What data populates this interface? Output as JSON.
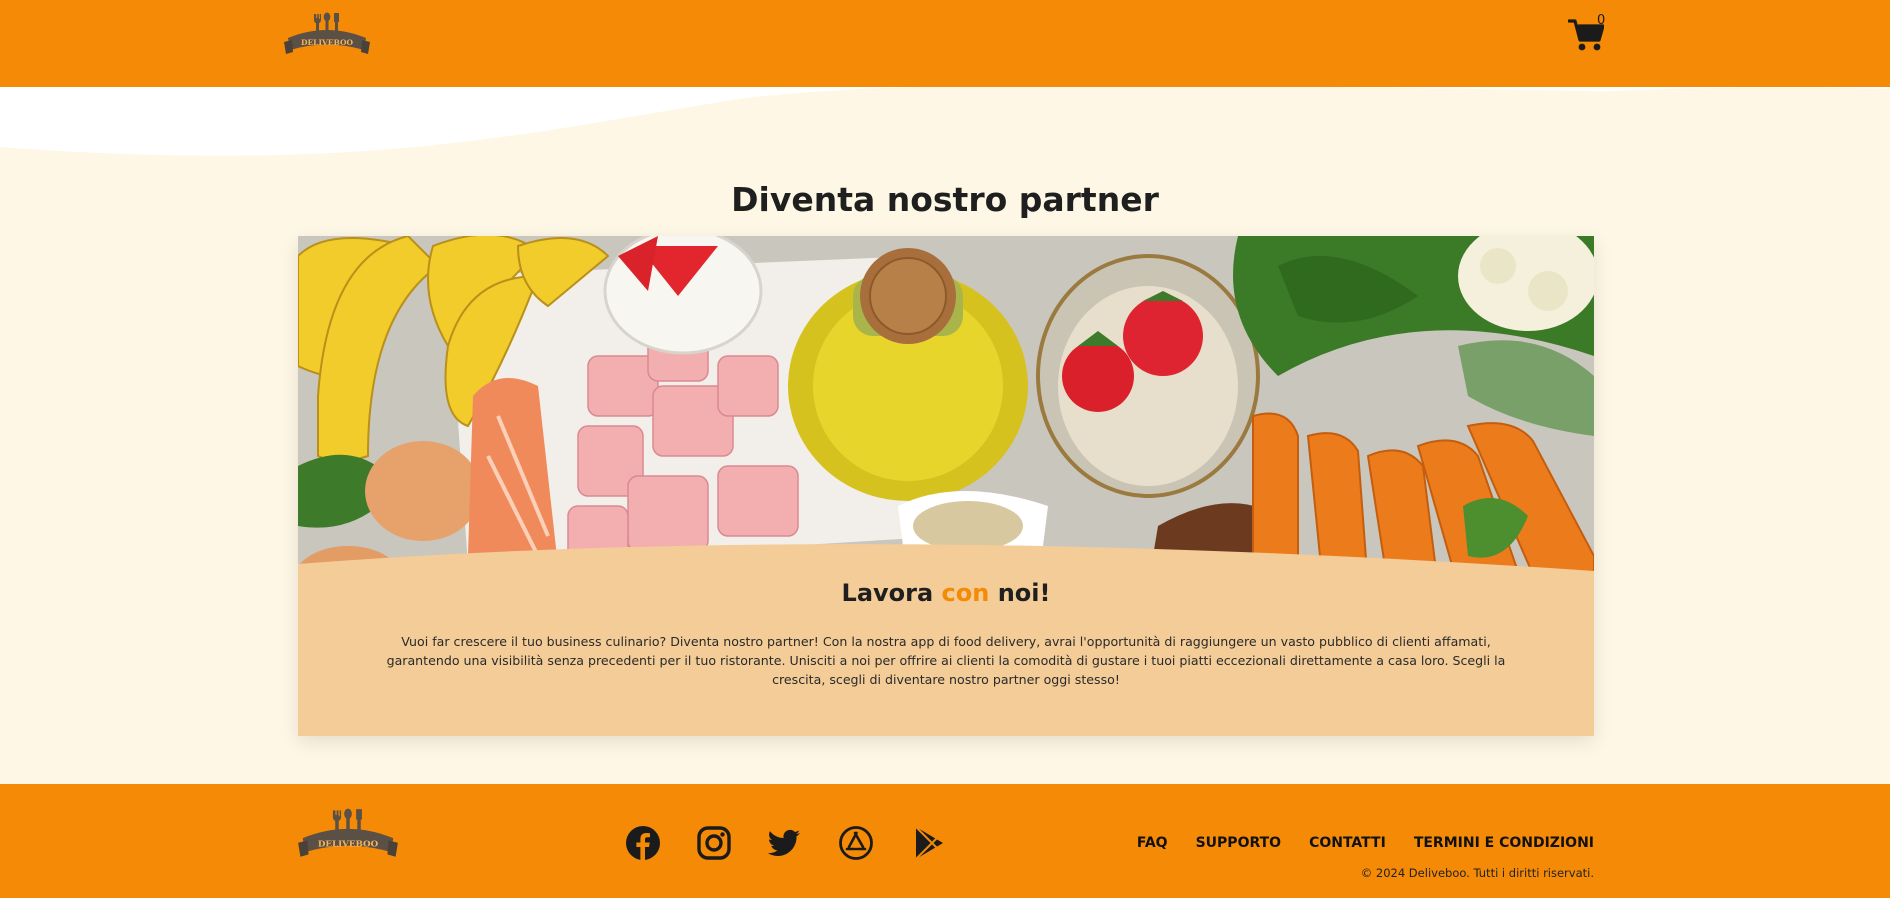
{
  "header": {
    "logo_text": "DELIVEBOO",
    "cart_count": "0"
  },
  "main": {
    "title": "Diventa nostro partner",
    "card": {
      "heading_part1": "Lavora ",
      "heading_accent": "con",
      "heading_part2": " noi!",
      "text": "Vuoi far crescere il tuo business culinario? Diventa nostro partner! Con la nostra app di food delivery, avrai l'opportunità di raggiungere un vasto pubblico di clienti affamati, garantendo una visibilità senza precedenti per il tuo ristorante. Unisciti a noi per offrire ai clienti la comodità di gustare i tuoi piatti eccezionali direttamente a casa loro. Scegli la crescita, scegli di diventare nostro partner oggi stesso!"
    }
  },
  "footer": {
    "logo_text": "DELIVEBOO",
    "socials": [
      "facebook-icon",
      "instagram-icon",
      "twitter-icon",
      "app-store-icon",
      "google-play-icon"
    ],
    "links": [
      "FAQ",
      "SUPPORTO",
      "CONTATTI",
      "TERMINI E CONDIZIONI"
    ],
    "copyright": "© 2024 Deliveboo. Tutti i diritti riservati."
  },
  "colors": {
    "brand_orange": "#f48a06",
    "cream_bg": "#fef7e5",
    "card_bg": "#f3cc98",
    "logo_dark": "#5a5046"
  }
}
